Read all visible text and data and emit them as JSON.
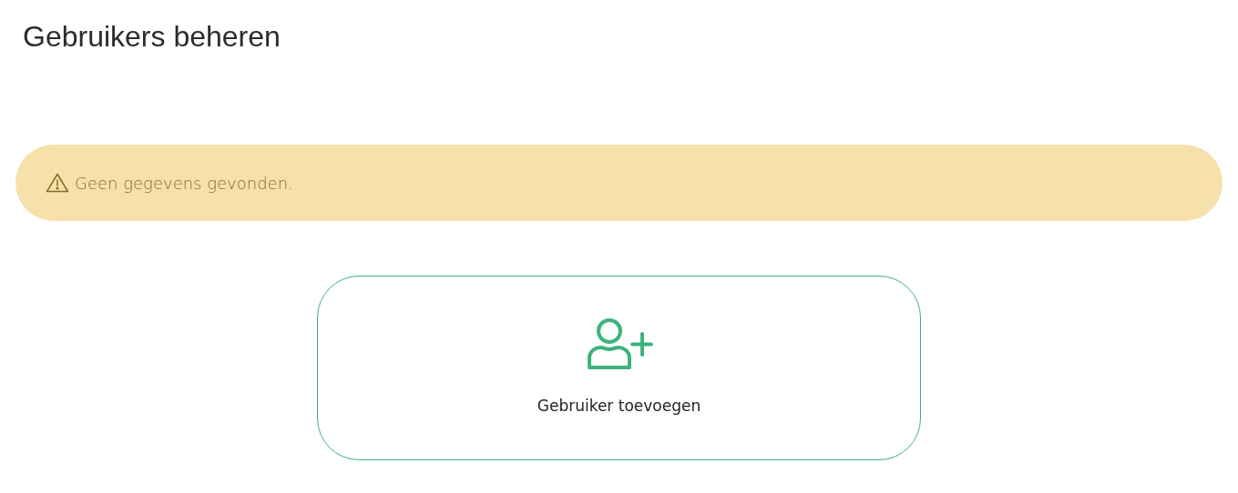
{
  "page": {
    "title": "Gebruikers beheren"
  },
  "alert": {
    "kind": "warning",
    "message": "Geen gegevens gevonden."
  },
  "add_card": {
    "label": "Gebruiker toevoegen"
  }
}
